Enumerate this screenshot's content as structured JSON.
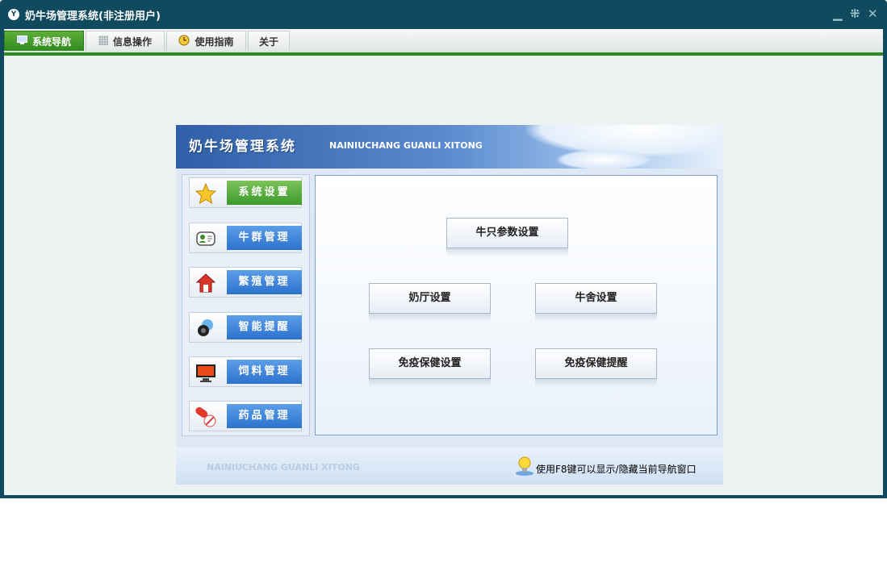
{
  "window": {
    "title": "奶牛场管理系统(非注册用户)",
    "logo_text": "Y"
  },
  "controls": {
    "minimize": "▁",
    "restore": "⁜",
    "close": "✕"
  },
  "tabs": [
    {
      "label": "系统导航",
      "icon": "monitor-icon",
      "active": true
    },
    {
      "label": "信息操作",
      "icon": "grid-icon",
      "active": false
    },
    {
      "label": "使用指南",
      "icon": "clock-icon",
      "active": false
    },
    {
      "label": "关于",
      "icon": "",
      "active": false
    }
  ],
  "banner": {
    "title": "奶牛场管理系统",
    "subtitle": "NAINIUCHANG GUANLI XITONG"
  },
  "nav": [
    {
      "label": "系统设置",
      "icon": "star-icon",
      "active": true
    },
    {
      "label": "牛群管理",
      "icon": "contact-card-icon",
      "active": false
    },
    {
      "label": "繁殖管理",
      "icon": "home-icon",
      "active": false
    },
    {
      "label": "智能提醒",
      "icon": "speaker-icon",
      "active": false
    },
    {
      "label": "饲料管理",
      "icon": "monitor-icon",
      "active": false
    },
    {
      "label": "药品管理",
      "icon": "pill-icon",
      "active": false
    }
  ],
  "buttons": {
    "cattle_params": "牛只参数设置",
    "milking_parlor": "奶厅设置",
    "barn": "牛舍设置",
    "immunization": "免疫保健设置",
    "immunization_reminder": "免疫保健提醒"
  },
  "footer": {
    "brand": "NAINIUCHANG GUANLI XITONG",
    "tip": "使用F8键可以显示/隐藏当前导航窗口"
  },
  "colors": {
    "frame": "#0f4a5e",
    "tab_active": "#2c8a1e",
    "nav_blue": "#2c72cd",
    "nav_active": "#3c9a2a"
  }
}
